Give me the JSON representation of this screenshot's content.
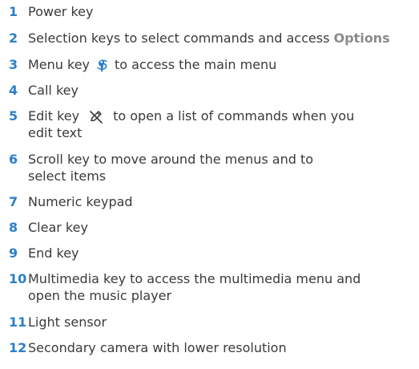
{
  "items": [
    {
      "number": "1",
      "lines": [
        "Power key"
      ]
    },
    {
      "number": "2",
      "text_before": "Selection keys to select commands and access ",
      "options_word": "Options"
    },
    {
      "number": "3",
      "text_before": "Menu key",
      "icon": "menu-key-icon",
      "text_after": "to access the main menu"
    },
    {
      "number": "4",
      "lines": [
        "Call key"
      ]
    },
    {
      "number": "5",
      "text_before": "Edit key",
      "icon": "edit-key-icon",
      "text_after": "to open a list of commands when you",
      "line2": "edit text"
    },
    {
      "number": "6",
      "lines": [
        "Scroll key to move around the menus and to",
        "select items"
      ]
    },
    {
      "number": "7",
      "lines": [
        "Numeric keypad"
      ]
    },
    {
      "number": "8",
      "lines": [
        "Clear key"
      ]
    },
    {
      "number": "9",
      "lines": [
        "End key"
      ]
    },
    {
      "number": "10",
      "lines": [
        "Multimedia key to access the multimedia menu and",
        "open the music player"
      ]
    },
    {
      "number": "11",
      "lines": [
        "Light sensor"
      ]
    },
    {
      "number": "12",
      "lines": [
        "Secondary camera with lower resolution"
      ]
    }
  ],
  "colors": {
    "number_accent": "#2a7fc9",
    "body_text": "#3a3a3a",
    "options_text": "#8a8a8a"
  }
}
